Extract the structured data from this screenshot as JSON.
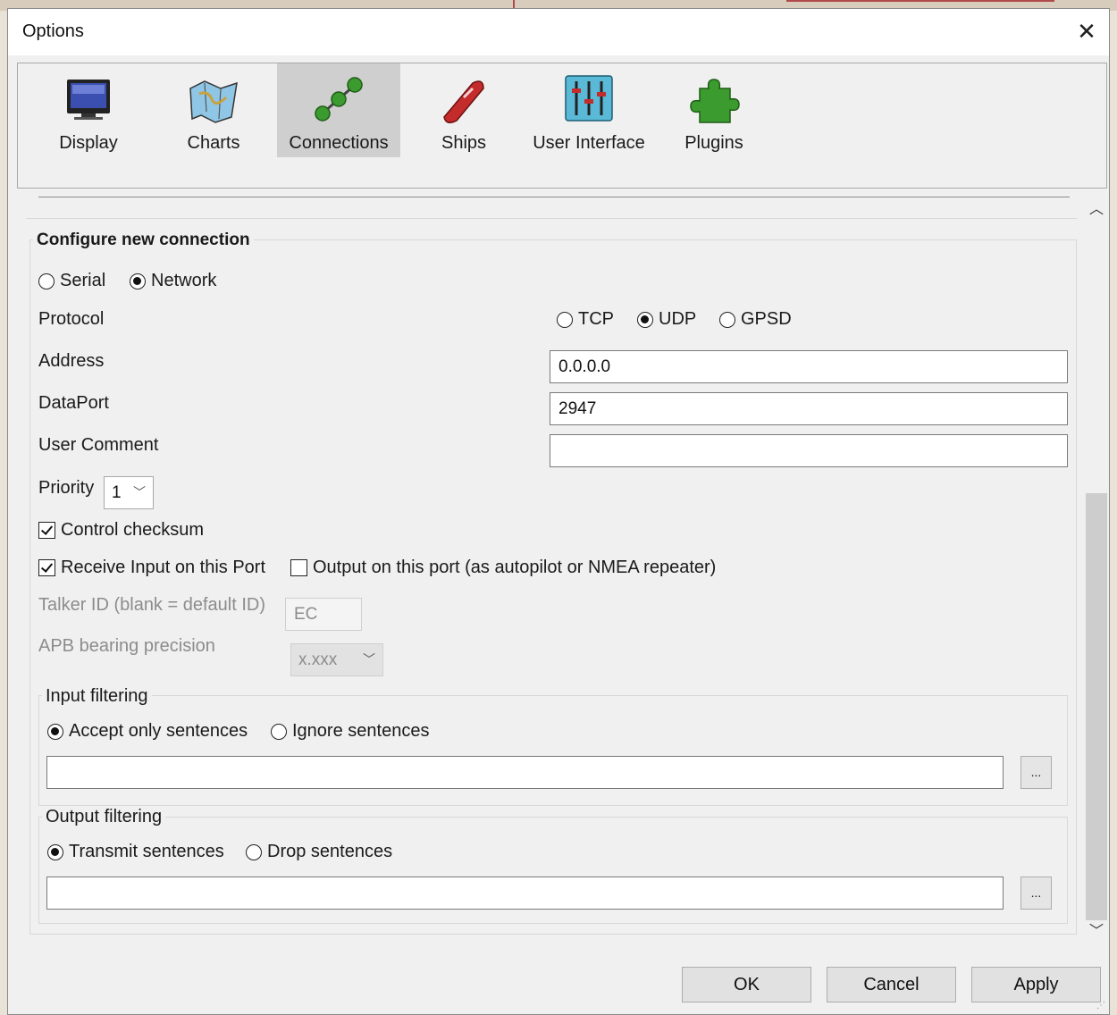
{
  "window": {
    "title": "Options",
    "close_glyph": "✕"
  },
  "toolbar": {
    "items": [
      {
        "label": "Display",
        "icon": "monitor-icon",
        "selected": false
      },
      {
        "label": "Charts",
        "icon": "chart-map-icon",
        "selected": false
      },
      {
        "label": "Connections",
        "icon": "connections-icon",
        "selected": true
      },
      {
        "label": "Ships",
        "icon": "ship-icon",
        "selected": false
      },
      {
        "label": "User Interface",
        "icon": "sliders-icon",
        "selected": false
      },
      {
        "label": "Plugins",
        "icon": "puzzle-icon",
        "selected": false
      }
    ]
  },
  "config": {
    "title": "Configure new connection",
    "type_options": [
      {
        "label": "Serial",
        "checked": false
      },
      {
        "label": "Network",
        "checked": true
      }
    ],
    "protocol_label": "Protocol",
    "protocol_options": [
      {
        "label": "TCP",
        "checked": false
      },
      {
        "label": "UDP",
        "checked": true
      },
      {
        "label": "GPSD",
        "checked": false
      }
    ],
    "address_label": "Address",
    "address_value": "0.0.0.0",
    "dataport_label": "DataPort",
    "dataport_value": "2947",
    "comment_label": "User Comment",
    "comment_value": "",
    "priority_label": "Priority",
    "priority_value": "1",
    "control_checksum": {
      "label": "Control checksum",
      "checked": true
    },
    "receive_input": {
      "label": "Receive Input on this Port",
      "checked": true
    },
    "output_port": {
      "label": "Output on this port (as autopilot or NMEA repeater)",
      "checked": false
    },
    "talker_label": "Talker ID (blank = default ID)",
    "talker_value": "EC",
    "apb_label": "APB bearing precision",
    "apb_value": "x.xxx"
  },
  "input_filtering": {
    "title": "Input filtering",
    "options": [
      {
        "label": "Accept only sentences",
        "checked": true
      },
      {
        "label": "Ignore sentences",
        "checked": false
      }
    ],
    "value": "",
    "button": "..."
  },
  "output_filtering": {
    "title": "Output filtering",
    "options": [
      {
        "label": "Transmit sentences",
        "checked": true
      },
      {
        "label": "Drop sentences",
        "checked": false
      }
    ],
    "value": "",
    "button": "..."
  },
  "buttons": {
    "ok": "OK",
    "cancel": "Cancel",
    "apply": "Apply"
  },
  "colors": {
    "selected_tab": "#cfcfcf",
    "dialog_bg": "#f0f0f0",
    "accent_green": "#3b9b2e"
  }
}
